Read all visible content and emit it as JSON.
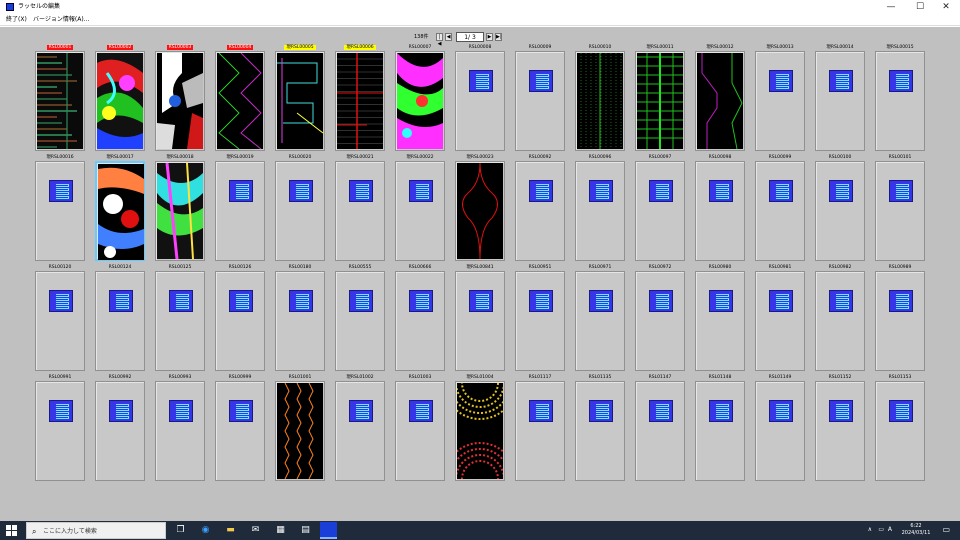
{
  "window": {
    "title": "ラッセルの編集",
    "minimize": "—",
    "maximize": "☐",
    "close": "✕"
  },
  "menu": [
    {
      "label": "終了(X)"
    },
    {
      "label": "バージョン情報(A)..."
    }
  ],
  "pager": {
    "count": "138件",
    "page": "1/ 3",
    "first": "|◀",
    "prev": "◀",
    "next": "▶",
    "last": "▶|"
  },
  "tiles": [
    {
      "label": "RSL00001",
      "style": "red",
      "thumb": "stripes-a"
    },
    {
      "label": "RSL00002",
      "style": "red",
      "thumb": "swirl"
    },
    {
      "label": "RSL00003",
      "style": "red",
      "thumb": "bw"
    },
    {
      "label": "RSL00004",
      "style": "red",
      "thumb": "zigzag"
    },
    {
      "label": "現RSL00005",
      "style": "yellow",
      "thumb": "steps"
    },
    {
      "label": "現RSL00006",
      "style": "yellow",
      "thumb": "redlines"
    },
    {
      "label": "RSL00007",
      "style": "plain",
      "thumb": "swirl2"
    },
    {
      "label": "RSL00008",
      "style": "plain"
    },
    {
      "label": "RSL00009",
      "style": "plain"
    },
    {
      "label": "RSL00010",
      "style": "plain",
      "thumb": "greengrid"
    },
    {
      "label": "現RSL00011",
      "style": "plain",
      "thumb": "greenbars"
    },
    {
      "label": "現RSL00012",
      "style": "plain",
      "thumb": "purplewave"
    },
    {
      "label": "現RSL00013",
      "style": "plain"
    },
    {
      "label": "現RSL00014",
      "style": "plain"
    },
    {
      "label": "現RSL00015",
      "style": "plain"
    },
    {
      "label": "現RSL00016",
      "style": "plain"
    },
    {
      "label": "現RSL00017",
      "style": "plain",
      "thumb": "swirl3",
      "selected": true
    },
    {
      "label": "現RSL00018",
      "style": "plain",
      "thumb": "swirl4"
    },
    {
      "label": "現RSL00019",
      "style": "plain"
    },
    {
      "label": "RSL00020",
      "style": "plain"
    },
    {
      "label": "現RSL00021",
      "style": "plain"
    },
    {
      "label": "現RSL00022",
      "style": "plain"
    },
    {
      "label": "現RSL00023",
      "style": "plain",
      "thumb": "redcurve"
    },
    {
      "label": "RSL00092",
      "style": "plain"
    },
    {
      "label": "RSL00096",
      "style": "plain"
    },
    {
      "label": "RSL00097",
      "style": "plain"
    },
    {
      "label": "RSL00098",
      "style": "plain"
    },
    {
      "label": "RSL00099",
      "style": "plain"
    },
    {
      "label": "RSL00100",
      "style": "plain"
    },
    {
      "label": "RSL00101",
      "style": "plain"
    },
    {
      "label": "RSL00120",
      "style": "plain"
    },
    {
      "label": "RSL00124",
      "style": "plain"
    },
    {
      "label": "RSL00125",
      "style": "plain"
    },
    {
      "label": "RSL00126",
      "style": "plain"
    },
    {
      "label": "RSL00180",
      "style": "plain"
    },
    {
      "label": "RSL00555",
      "style": "plain"
    },
    {
      "label": "RSL00666",
      "style": "plain"
    },
    {
      "label": "現RSL00841",
      "style": "plain"
    },
    {
      "label": "RSL00951",
      "style": "plain"
    },
    {
      "label": "RSL00971",
      "style": "plain"
    },
    {
      "label": "RSL00972",
      "style": "plain"
    },
    {
      "label": "RSL00980",
      "style": "plain"
    },
    {
      "label": "RSL00981",
      "style": "plain"
    },
    {
      "label": "RSL00982",
      "style": "plain"
    },
    {
      "label": "RSL00989",
      "style": "plain"
    },
    {
      "label": "RSL00991",
      "style": "plain"
    },
    {
      "label": "RSL00992",
      "style": "plain"
    },
    {
      "label": "RSL00993",
      "style": "plain"
    },
    {
      "label": "RSL00999",
      "style": "plain"
    },
    {
      "label": "RSL01001",
      "style": "plain",
      "thumb": "orangezig"
    },
    {
      "label": "現RSL01002",
      "style": "plain"
    },
    {
      "label": "RSL01003",
      "style": "plain"
    },
    {
      "label": "現RSL01004",
      "style": "plain",
      "thumb": "arcs"
    },
    {
      "label": "RSL01117",
      "style": "plain"
    },
    {
      "label": "RSL01135",
      "style": "plain"
    },
    {
      "label": "RSL01147",
      "style": "plain"
    },
    {
      "label": "RSL01148",
      "style": "plain"
    },
    {
      "label": "RSL01149",
      "style": "plain"
    },
    {
      "label": "RSL01152",
      "style": "plain"
    },
    {
      "label": "RSL01153",
      "style": "plain"
    }
  ],
  "taskbar": {
    "search_placeholder": "ここに入力して検索",
    "time": "6:22",
    "date": "2024/03/11",
    "ime": "A"
  }
}
